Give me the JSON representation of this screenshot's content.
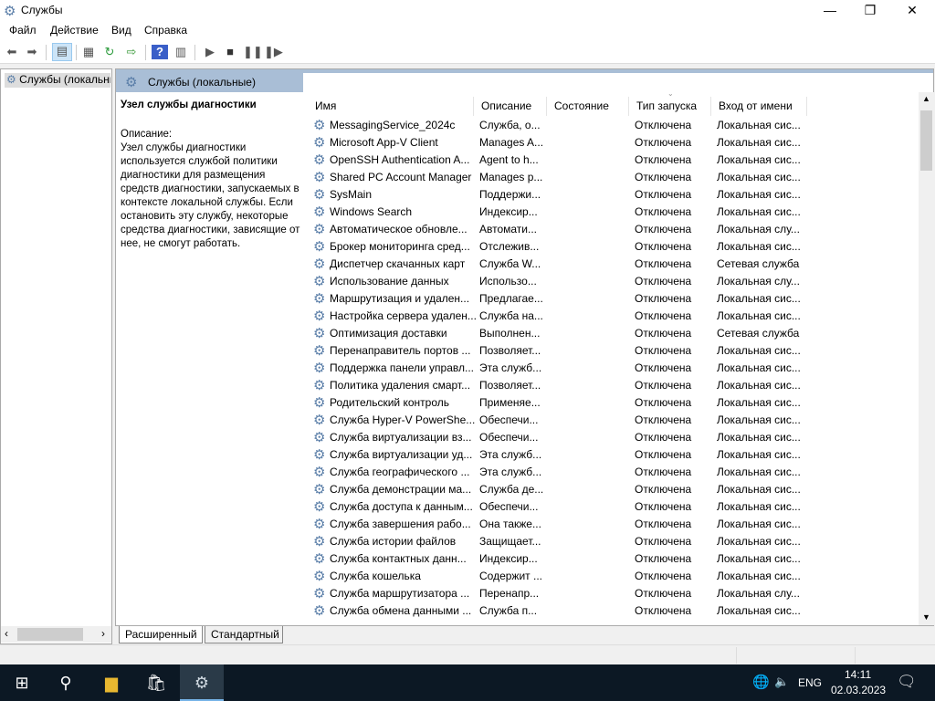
{
  "window": {
    "title": "Службы",
    "minimize": "—",
    "maximize": "❐",
    "close": "✕"
  },
  "menu": [
    "Файл",
    "Действие",
    "Вид",
    "Справка"
  ],
  "tree": {
    "root": "Службы (локальные)"
  },
  "header": {
    "title": "Службы (локальные)"
  },
  "description": {
    "heading": "Узел службы диагностики",
    "label": "Описание:",
    "text": "Узел службы диагностики используется службой политики диагностики для размещения средств диагностики, запускаемых в контексте локальной службы. Если остановить эту службу, некоторые средства диагностики, зависящие от нее, не смогут работать."
  },
  "columns": [
    "Имя",
    "Описание",
    "Состояние",
    "Тип запуска",
    "Вход от имени"
  ],
  "rows": [
    [
      "MessagingService_2024c",
      "Служба, о...",
      "",
      "Отключена",
      "Локальная сис..."
    ],
    [
      "Microsoft App-V Client",
      "Manages A...",
      "",
      "Отключена",
      "Локальная сис..."
    ],
    [
      "OpenSSH Authentication A...",
      "Agent to h...",
      "",
      "Отключена",
      "Локальная сис..."
    ],
    [
      "Shared PC Account Manager",
      "Manages p...",
      "",
      "Отключена",
      "Локальная сис..."
    ],
    [
      "SysMain",
      "Поддержи...",
      "",
      "Отключена",
      "Локальная сис..."
    ],
    [
      "Windows Search",
      "Индексир...",
      "",
      "Отключена",
      "Локальная сис..."
    ],
    [
      "Автоматическое обновле...",
      "Автомати...",
      "",
      "Отключена",
      "Локальная слу..."
    ],
    [
      "Брокер мониторинга сред...",
      "Отслежив...",
      "",
      "Отключена",
      "Локальная сис..."
    ],
    [
      "Диспетчер скачанных карт",
      "Служба W...",
      "",
      "Отключена",
      "Сетевая служба"
    ],
    [
      "Использование данных",
      "Использо...",
      "",
      "Отключена",
      "Локальная слу..."
    ],
    [
      "Маршрутизация и удален...",
      "Предлагае...",
      "",
      "Отключена",
      "Локальная сис..."
    ],
    [
      "Настройка сервера удален...",
      "Служба на...",
      "",
      "Отключена",
      "Локальная сис..."
    ],
    [
      "Оптимизация доставки",
      "Выполнен...",
      "",
      "Отключена",
      "Сетевая служба"
    ],
    [
      "Перенаправитель портов ...",
      "Позволяет...",
      "",
      "Отключена",
      "Локальная сис..."
    ],
    [
      "Поддержка панели управл...",
      "Эта служб...",
      "",
      "Отключена",
      "Локальная сис..."
    ],
    [
      "Политика удаления смарт...",
      "Позволяет...",
      "",
      "Отключена",
      "Локальная сис..."
    ],
    [
      "Родительский контроль",
      "Применяе...",
      "",
      "Отключена",
      "Локальная сис..."
    ],
    [
      "Служба Hyper-V PowerShe...",
      "Обеспечи...",
      "",
      "Отключена",
      "Локальная сис..."
    ],
    [
      "Служба виртуализации вз...",
      "Обеспечи...",
      "",
      "Отключена",
      "Локальная сис..."
    ],
    [
      "Служба виртуализации уд...",
      "Эта служб...",
      "",
      "Отключена",
      "Локальная сис..."
    ],
    [
      "Служба географического ...",
      "Эта служб...",
      "",
      "Отключена",
      "Локальная сис..."
    ],
    [
      "Служба демонстрации ма...",
      "Служба де...",
      "",
      "Отключена",
      "Локальная сис..."
    ],
    [
      "Служба доступа к данным...",
      "Обеспечи...",
      "",
      "Отключена",
      "Локальная сис..."
    ],
    [
      "Служба завершения рабо...",
      "Она также...",
      "",
      "Отключена",
      "Локальная сис..."
    ],
    [
      "Служба истории файлов",
      "Защищает...",
      "",
      "Отключена",
      "Локальная сис..."
    ],
    [
      "Служба контактных данн...",
      "Индексир...",
      "",
      "Отключена",
      "Локальная сис..."
    ],
    [
      "Служба кошелька",
      "Содержит ...",
      "",
      "Отключена",
      "Локальная сис..."
    ],
    [
      "Служба маршрутизатора ...",
      "Перенапр...",
      "",
      "Отключена",
      "Локальная слу..."
    ],
    [
      "Служба обмена данными ...",
      "Служба п...",
      "",
      "Отключена",
      "Локальная сис..."
    ]
  ],
  "tabs": [
    "Расширенный",
    "Стандартный"
  ],
  "taskbar": {
    "lang": "ENG",
    "time": "14:11",
    "date": "02.03.2023"
  }
}
